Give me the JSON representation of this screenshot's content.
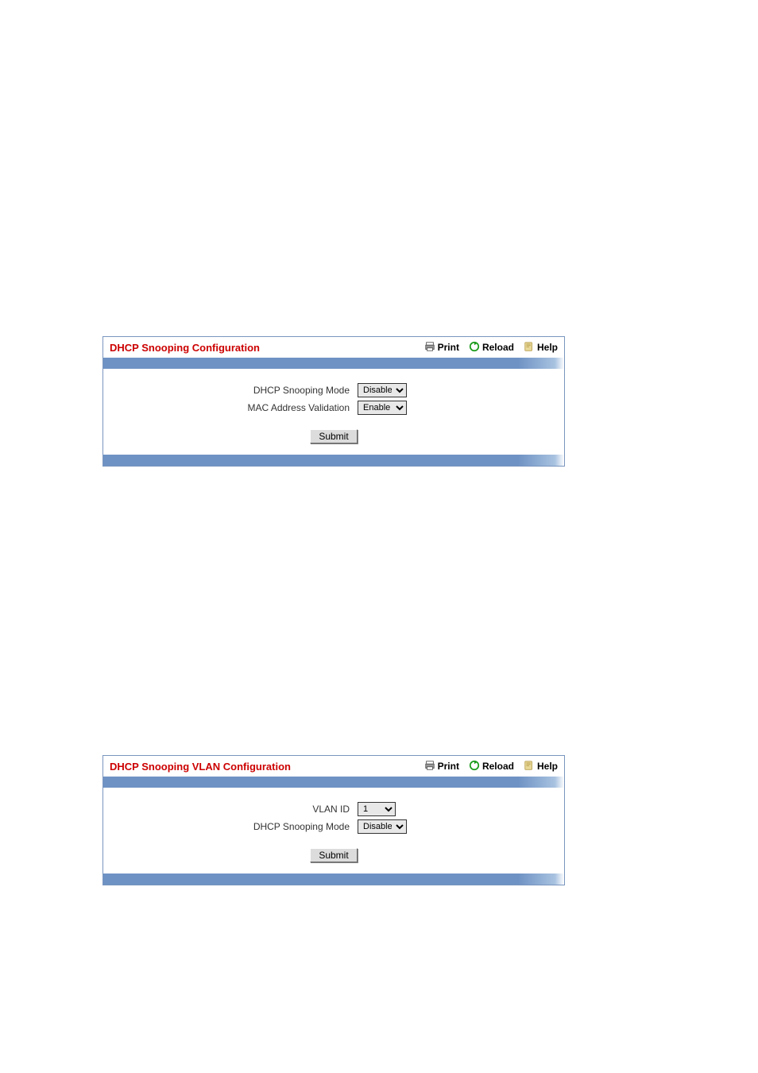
{
  "toolbar": {
    "print": "Print",
    "reload": "Reload",
    "help": "Help"
  },
  "panel1": {
    "title": "DHCP Snooping Configuration",
    "rows": {
      "snooping_mode_label": "DHCP Snooping Mode",
      "snooping_mode_value": "Disable",
      "mac_validation_label": "MAC Address Validation",
      "mac_validation_value": "Enable"
    },
    "submit": "Submit"
  },
  "panel2": {
    "title": "DHCP Snooping VLAN Configuration",
    "rows": {
      "vlan_id_label": "VLAN ID",
      "vlan_id_value": "1",
      "snooping_mode_label": "DHCP Snooping Mode",
      "snooping_mode_value": "Disable"
    },
    "submit": "Submit"
  }
}
